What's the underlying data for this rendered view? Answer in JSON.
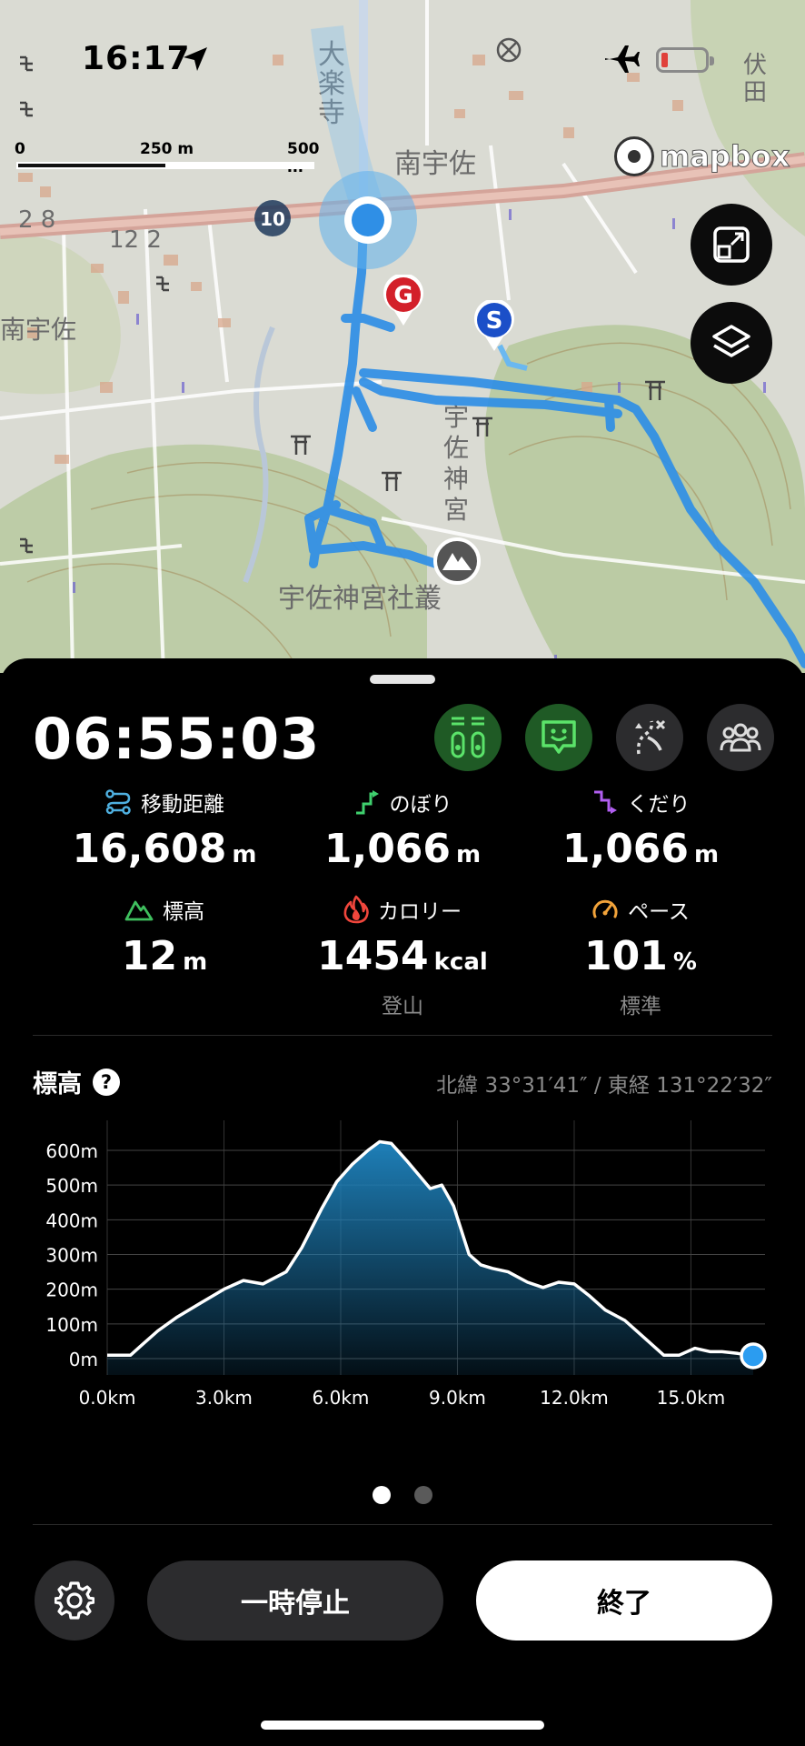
{
  "status_bar": {
    "time": "16:17",
    "battery_color": "#e0413a"
  },
  "map": {
    "scale_labels": [
      "0",
      "250 m",
      "500 m"
    ],
    "attribution": "mapbox",
    "place_labels": [
      "大楽寺",
      "南宇佐",
      "南宇佐",
      "宇佐神宮",
      "宇佐神宮社叢",
      "伏田"
    ],
    "road_number": "10",
    "markers": {
      "goal": "G",
      "start": "S"
    },
    "route_color": "#2f8fe6",
    "buttons": {
      "fit": "fit-bounds-icon",
      "layers": "layers-icon"
    }
  },
  "activity": {
    "elapsed": "06:55:03",
    "mode_buttons": [
      {
        "icon": "gauges-icon",
        "active": true
      },
      {
        "icon": "chat-face-icon",
        "active": true
      },
      {
        "icon": "route-branch-icon",
        "active": false
      },
      {
        "icon": "group-icon",
        "active": false
      }
    ],
    "stats": {
      "distance": {
        "label": "移動距離",
        "value": "16,608",
        "unit": "m",
        "icon_color": "#4fb0e0"
      },
      "ascent": {
        "label": "のぼり",
        "value": "1,066",
        "unit": "m",
        "icon_color": "#3fcf6e"
      },
      "descent": {
        "label": "くだり",
        "value": "1,066",
        "unit": "m",
        "icon_color": "#b15ef0"
      },
      "elevation": {
        "label": "標高",
        "value": "12",
        "unit": "m",
        "icon_color": "#3fbf5e"
      },
      "calories": {
        "label": "カロリー",
        "value": "1454",
        "unit": "kcal",
        "sub": "登山",
        "icon_color": "#f0463c"
      },
      "pace": {
        "label": "ペース",
        "value": "101",
        "unit": "%",
        "sub": "標準",
        "icon_color": "#f2a33a"
      }
    }
  },
  "elevation_section": {
    "title": "標高",
    "coordinates": "北緯 33°31′41″ / 東経 131°22′32″"
  },
  "chart_data": {
    "type": "area",
    "ylabel_ticks": [
      "600m",
      "500m",
      "400m",
      "300m",
      "200m",
      "100m",
      "0m"
    ],
    "xlabel_ticks": [
      "0.0km",
      "3.0km",
      "6.0km",
      "9.0km",
      "12.0km",
      "15.0km"
    ],
    "x_unit": "km",
    "y_unit": "m",
    "xlim": [
      0,
      16.6
    ],
    "ylim": [
      0,
      620
    ],
    "x": [
      0,
      0.6,
      0.9,
      1.3,
      1.8,
      2.4,
      3.0,
      3.5,
      4.0,
      4.6,
      5.0,
      5.5,
      5.9,
      6.3,
      6.7,
      7.0,
      7.3,
      7.7,
      8.0,
      8.3,
      8.6,
      8.9,
      9.3,
      9.6,
      9.9,
      10.3,
      10.8,
      11.2,
      11.6,
      12.0,
      12.4,
      12.8,
      13.3,
      13.8,
      14.3,
      14.7,
      15.1,
      15.5,
      15.8,
      16.2,
      16.6
    ],
    "y": [
      10,
      10,
      40,
      80,
      120,
      160,
      200,
      225,
      215,
      250,
      320,
      430,
      510,
      560,
      600,
      625,
      620,
      570,
      530,
      490,
      500,
      440,
      300,
      270,
      260,
      250,
      220,
      205,
      220,
      215,
      180,
      140,
      110,
      60,
      10,
      10,
      30,
      20,
      20,
      15,
      8
    ],
    "current_point": [
      16.6,
      8
    ],
    "line_color": "#ffffff",
    "fill_color": "#1e7fb8",
    "marker_color": "#2b9cf0"
  },
  "pager": {
    "active_index": 0,
    "count": 2
  },
  "controls": {
    "pause_label": "一時停止",
    "end_label": "終了"
  }
}
